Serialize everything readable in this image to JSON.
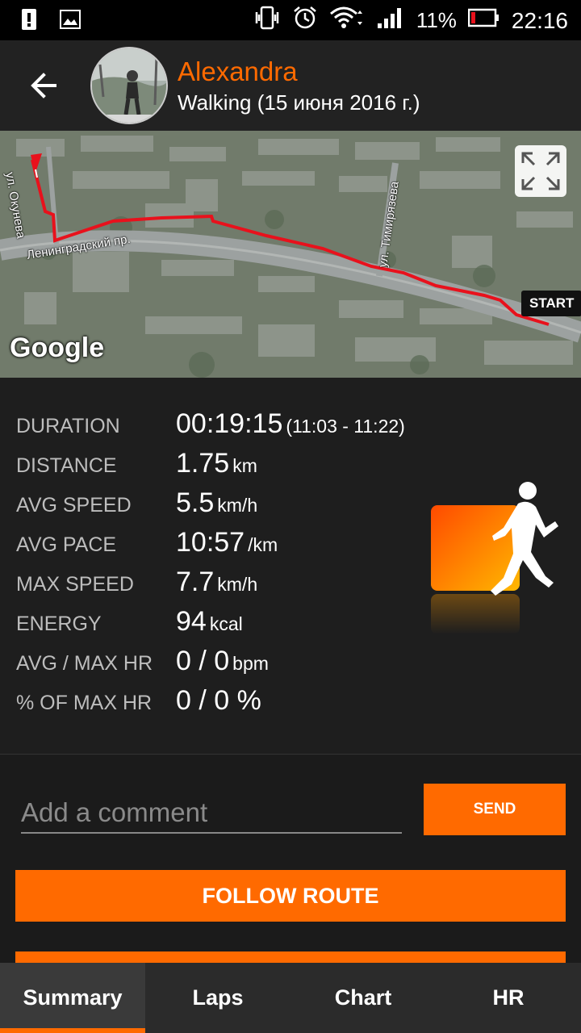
{
  "status_bar": {
    "battery_percent": "11%",
    "time": "22:16",
    "icons": [
      "alert-icon",
      "image-icon",
      "vibrate-icon",
      "alarm-icon",
      "wifi-icon",
      "signal-icon",
      "battery-icon"
    ]
  },
  "header": {
    "user_name": "Alexandra",
    "activity_line": "Walking (15 июня 2016 г.)"
  },
  "map": {
    "street_1": "ул. Окунева",
    "street_2": "Ленинградский пр.",
    "street_3": "ул. Тимирязева",
    "start_label": "START",
    "attribution": "Google",
    "route_color": "#e8111c"
  },
  "stats": [
    {
      "label": "DURATION",
      "value": "00:19:15",
      "unit": "(11:03 - 11:22)"
    },
    {
      "label": "DISTANCE",
      "value": "1.75",
      "unit": "km"
    },
    {
      "label": "AVG SPEED",
      "value": "5.5",
      "unit": "km/h"
    },
    {
      "label": "AVG PACE",
      "value": "10:57",
      "unit": "/km"
    },
    {
      "label": "MAX SPEED",
      "value": "7.7",
      "unit": "km/h"
    },
    {
      "label": "ENERGY",
      "value": "94",
      "unit": "kcal"
    },
    {
      "label": "AVG / MAX HR",
      "value": "0 / 0",
      "unit": "bpm"
    },
    {
      "label": "% OF MAX HR",
      "value": "0 / 0 %",
      "unit": ""
    }
  ],
  "comment": {
    "placeholder": "Add a comment",
    "send_label": "SEND"
  },
  "actions": {
    "follow_route_label": "FOLLOW ROUTE"
  },
  "tabs": [
    {
      "label": "Summary",
      "active": true
    },
    {
      "label": "Laps",
      "active": false
    },
    {
      "label": "Chart",
      "active": false
    },
    {
      "label": "HR",
      "active": false
    }
  ],
  "colors": {
    "accent": "#ff6a00",
    "background": "#1e1e1e"
  }
}
